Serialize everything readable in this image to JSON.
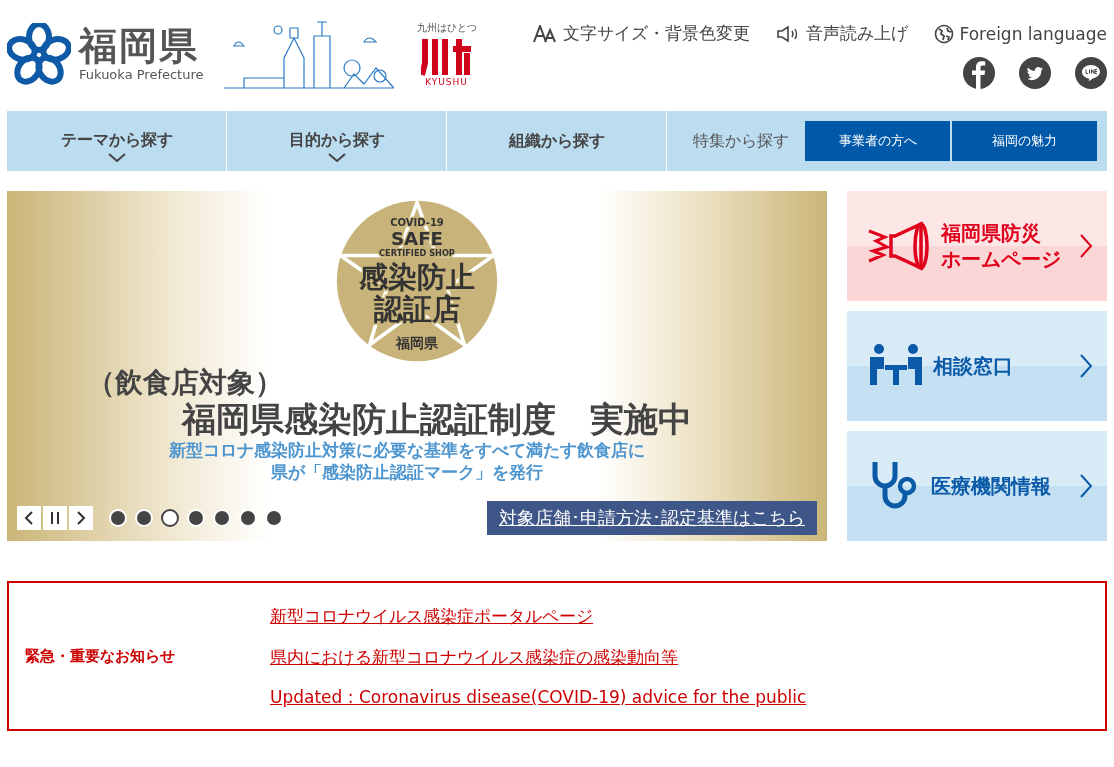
{
  "header": {
    "logo": {
      "name": "福岡県",
      "subtitle": "Fukuoka Prefecture"
    },
    "kyushu_logo": {
      "tagline": "九州はひとつ",
      "word": "KYUSHU"
    },
    "utilities": [
      {
        "kind": "text-size",
        "label": "文字サイズ・背景色変更"
      },
      {
        "kind": "speech",
        "label": "音声読み上げ"
      },
      {
        "kind": "language",
        "label": "Foreign language"
      }
    ],
    "social": [
      {
        "kind": "facebook"
      },
      {
        "kind": "twitter"
      },
      {
        "kind": "line"
      }
    ]
  },
  "nav": {
    "items": [
      {
        "label": "テーマから探す",
        "has_menu": true
      },
      {
        "label": "目的から探す",
        "has_menu": true
      },
      {
        "label": "組織から探す",
        "has_menu": false
      }
    ],
    "feature": {
      "label": "特集から探す",
      "buttons": [
        "事業者の方へ",
        "福岡の魅力"
      ]
    }
  },
  "banner": {
    "sticker": {
      "line_1": "COVID-19",
      "line_2": "SAFE",
      "line_3": "CERTIFIED SHOP",
      "line_4": "感染防止",
      "line_5": "認証店",
      "badge": "福岡県"
    },
    "heading_small": "（飲食店対象）",
    "heading": "福岡県感染防止認証制度　実施中",
    "sub_lines": [
      "新型コロナ感染防止対策に必要な基準をすべて満たす飲食店に",
      "県が「感染防止認証マーク」を発行"
    ],
    "cta": "対象店舗･申請方法･認定基準はこちら",
    "dots": [
      {
        "selected": false
      },
      {
        "selected": false
      },
      {
        "selected": true
      },
      {
        "selected": false
      },
      {
        "selected": false
      },
      {
        "selected": false
      },
      {
        "selected": false
      }
    ]
  },
  "side_links": [
    {
      "kind": "disaster",
      "lines": [
        "福岡県防災",
        "ホームページ"
      ]
    },
    {
      "kind": "consult",
      "lines": [
        "相談窓口"
      ]
    },
    {
      "kind": "medical",
      "lines": [
        "医療機関情報"
      ]
    }
  ],
  "notice": {
    "title": "緊急・重要なお知らせ",
    "links": [
      "新型コロナウイルス感染症ポータルページ",
      "県内における新型コロナウイルス感染症の感染動向等",
      "Updated : Coronavirus disease(COVID-19) advice for the public"
    ]
  }
}
